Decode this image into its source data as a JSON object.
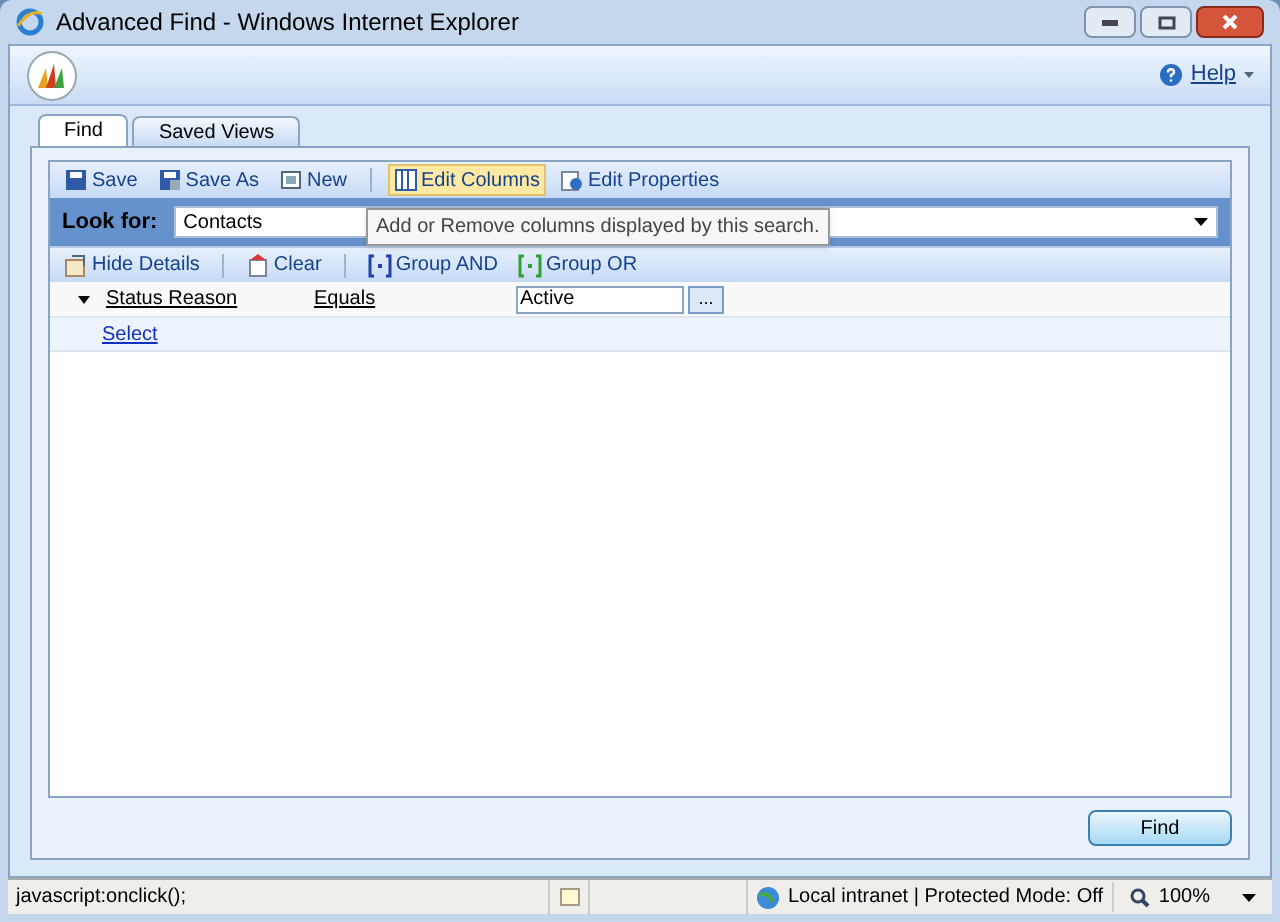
{
  "window": {
    "title": "Advanced Find - Windows Internet Explorer"
  },
  "header": {
    "help": "Help"
  },
  "tabs": [
    {
      "label": "Find",
      "selected": true
    },
    {
      "label": "Saved Views",
      "selected": false
    }
  ],
  "toolbar": [
    {
      "kind": "save",
      "label": "Save",
      "hover": false
    },
    {
      "kind": "saveas",
      "label": "Save As",
      "hover": false
    },
    {
      "kind": "new",
      "label": "New",
      "hover": false
    },
    {
      "kind": "sep"
    },
    {
      "kind": "columns",
      "label": "Edit Columns",
      "hover": true
    },
    {
      "kind": "properties",
      "label": "Edit Properties",
      "hover": false
    }
  ],
  "look_for": {
    "label": "Look for:",
    "value": "Contacts"
  },
  "tooltip": "Add or Remove columns displayed by this search.",
  "criteria_toolbar": [
    {
      "kind": "hide",
      "label": "Hide Details"
    },
    {
      "kind": "sep"
    },
    {
      "kind": "clear",
      "label": "Clear"
    },
    {
      "kind": "sep"
    },
    {
      "kind": "and",
      "label": "Group AND"
    },
    {
      "kind": "or",
      "label": "Group OR"
    }
  ],
  "criteria": [
    {
      "field": "Status Reason",
      "operator": "Equals",
      "value": "Active",
      "button": "..."
    }
  ],
  "select_link": "Select",
  "find_button": "Find",
  "status_bar": {
    "text": "javascript:onclick();",
    "zone": "Local intranet | Protected Mode: Off",
    "zoom": "100%"
  }
}
